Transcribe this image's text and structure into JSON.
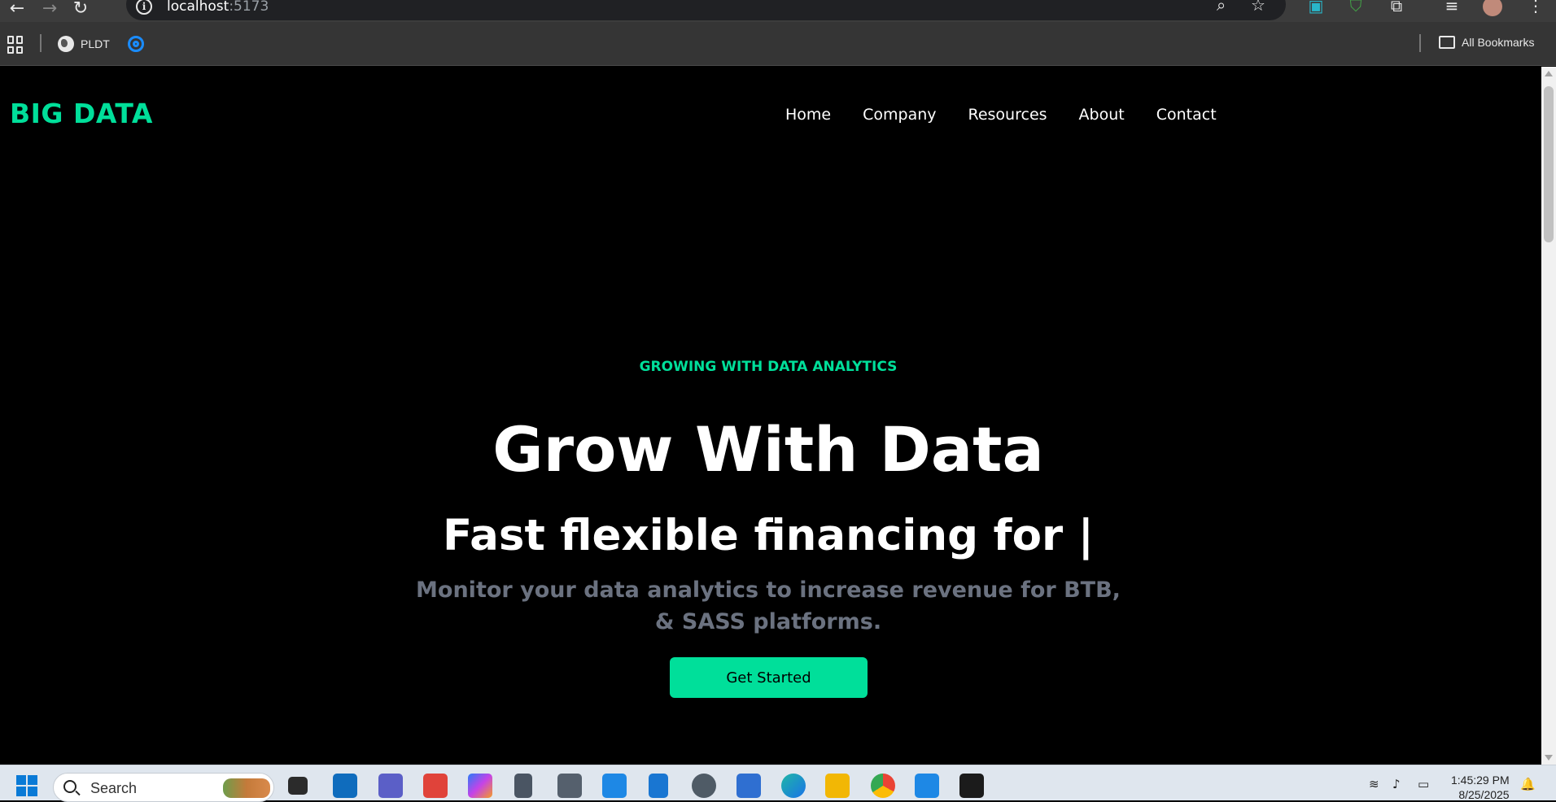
{
  "browser": {
    "url_host": "localhost",
    "url_port": ":5173",
    "bookmarks": [
      {
        "label": "PLDT"
      }
    ],
    "all_bookmarks_label": "All Bookmarks"
  },
  "site": {
    "brand": "BIG DATA",
    "nav": [
      "Home",
      "Company",
      "Resources",
      "About",
      "Contact"
    ],
    "eyebrow": "GROWING WITH DATA ANALYTICS",
    "title": "Grow With Data",
    "subtitle": "Fast flexible financing for |",
    "description": "Monitor your data analytics to increase revenue for BTB, & SASS platforms.",
    "cta_label": "Get Started",
    "accent_color": "#00df9a"
  },
  "taskbar": {
    "search_placeholder": "Search",
    "time": "1:45:29 PM",
    "date": "8/25/2025"
  }
}
